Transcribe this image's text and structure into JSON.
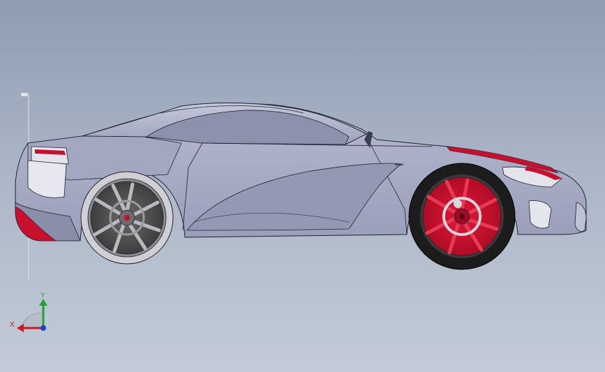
{
  "viewport": {
    "background_top": "#8f9db2",
    "background_bottom": "#c3cbd8"
  },
  "model": {
    "body_color": "#a7abc3",
    "body_shadow": "#8f93ad",
    "outline_color": "#1f2230",
    "accent_color": "#c8102e",
    "rear_rim_color": "#5a5a5a",
    "front_rim_color": "#c8102e",
    "tire_color": "#1c1c1c"
  },
  "triad": {
    "x_label": "X",
    "y_label": "Y",
    "x_color": "#d4141e",
    "y_color": "#1fa52a",
    "z_color": "#1a3fd6"
  }
}
